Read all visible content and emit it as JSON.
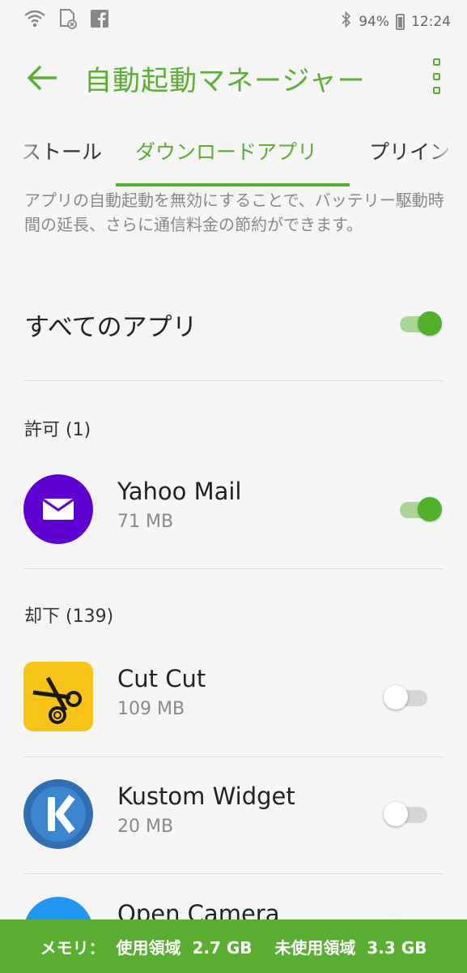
{
  "status": {
    "battery": "94%",
    "time": "12:24"
  },
  "header": {
    "title": "自動起動マネージャー"
  },
  "tabs": [
    {
      "label": "ストール"
    },
    {
      "label": "ダウンロードアプリ"
    },
    {
      "label": "プリイン"
    }
  ],
  "description": "アプリの自動起動を無効にすることで、バッテリー駆動時間の延長、さらに通信料金の節約ができます。",
  "all_apps": {
    "label": "すべてのアプリ",
    "enabled": true
  },
  "allowed": {
    "header": "許可 (1)",
    "apps": [
      {
        "name": "Yahoo Mail",
        "size": "71 MB",
        "enabled": true
      }
    ]
  },
  "denied": {
    "header": "却下 (139)",
    "apps": [
      {
        "name": "Cut Cut",
        "size": "109 MB",
        "enabled": false
      },
      {
        "name": "Kustom Widget",
        "size": "20 MB",
        "enabled": false
      },
      {
        "name": "Open Camera",
        "size": "",
        "enabled": false
      }
    ]
  },
  "memory": {
    "text": "メモリ：  使用領域  2.7 GB    未使用領域  3.3 GB"
  },
  "colors": {
    "accent": "#5aae32",
    "yahoo_purple": "#5f01d1",
    "cutcut_yellow": "#f7c316",
    "kustom_blue": "#2f6fb2",
    "opencamera_blue": "#2196f3"
  }
}
